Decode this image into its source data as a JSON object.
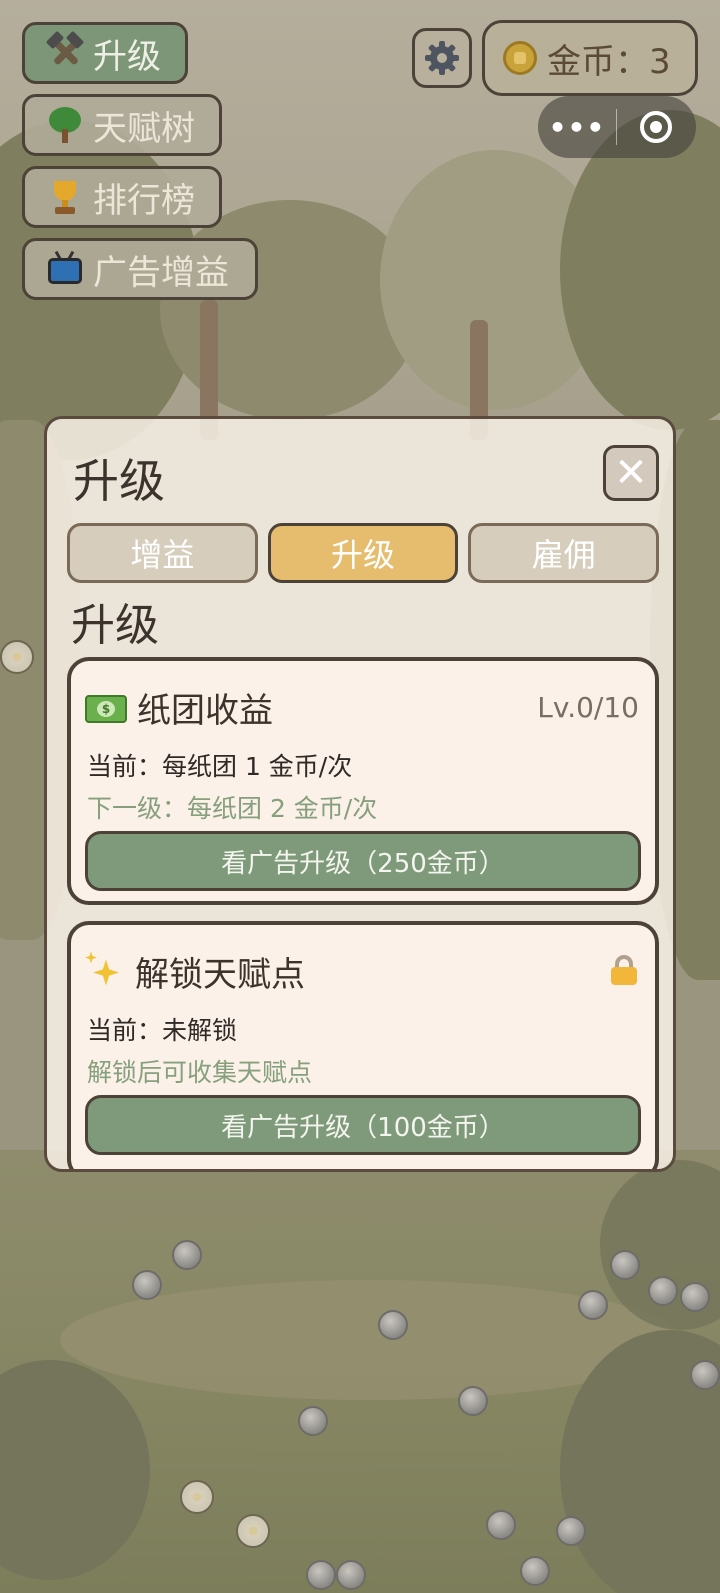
{
  "menu": {
    "items": [
      {
        "label": "升级",
        "icon": "hammer-pick-icon",
        "active": true
      },
      {
        "label": "天赋树",
        "icon": "tree-icon",
        "active": false
      },
      {
        "label": "排行榜",
        "icon": "trophy-icon",
        "active": false
      },
      {
        "label": "广告增益",
        "icon": "tv-icon",
        "active": false
      }
    ]
  },
  "header": {
    "settings_icon": "gear-icon",
    "coins_label": "金币：3",
    "capsule_more": "•••",
    "capsule_icon": "target-icon"
  },
  "dialog": {
    "title": "升级",
    "close_label": "✕",
    "tabs": [
      {
        "label": "增益",
        "active": false
      },
      {
        "label": "升级",
        "active": true
      },
      {
        "label": "雇佣",
        "active": false
      }
    ],
    "section_title": "升级",
    "cards": [
      {
        "icon": "money-icon",
        "name": "纸团收益",
        "level": "Lv.0/10",
        "current": "当前：每纸团 1 金币/次",
        "next": "下一级：每纸团 2 金币/次",
        "button": "看广告升级（250金币）"
      },
      {
        "icon": "sparkle-icon",
        "name": "解锁天赋点",
        "locked_icon": "lock-icon",
        "current": "当前：未解锁",
        "next": "解锁后可收集天赋点",
        "button": "看广告升级（100金币）"
      }
    ]
  },
  "colors": {
    "accent_active_tab": "#e6bd6e",
    "button_green": "#7f9a7b",
    "next_text_green": "#86a07d",
    "menu_active": "#7d9677"
  }
}
